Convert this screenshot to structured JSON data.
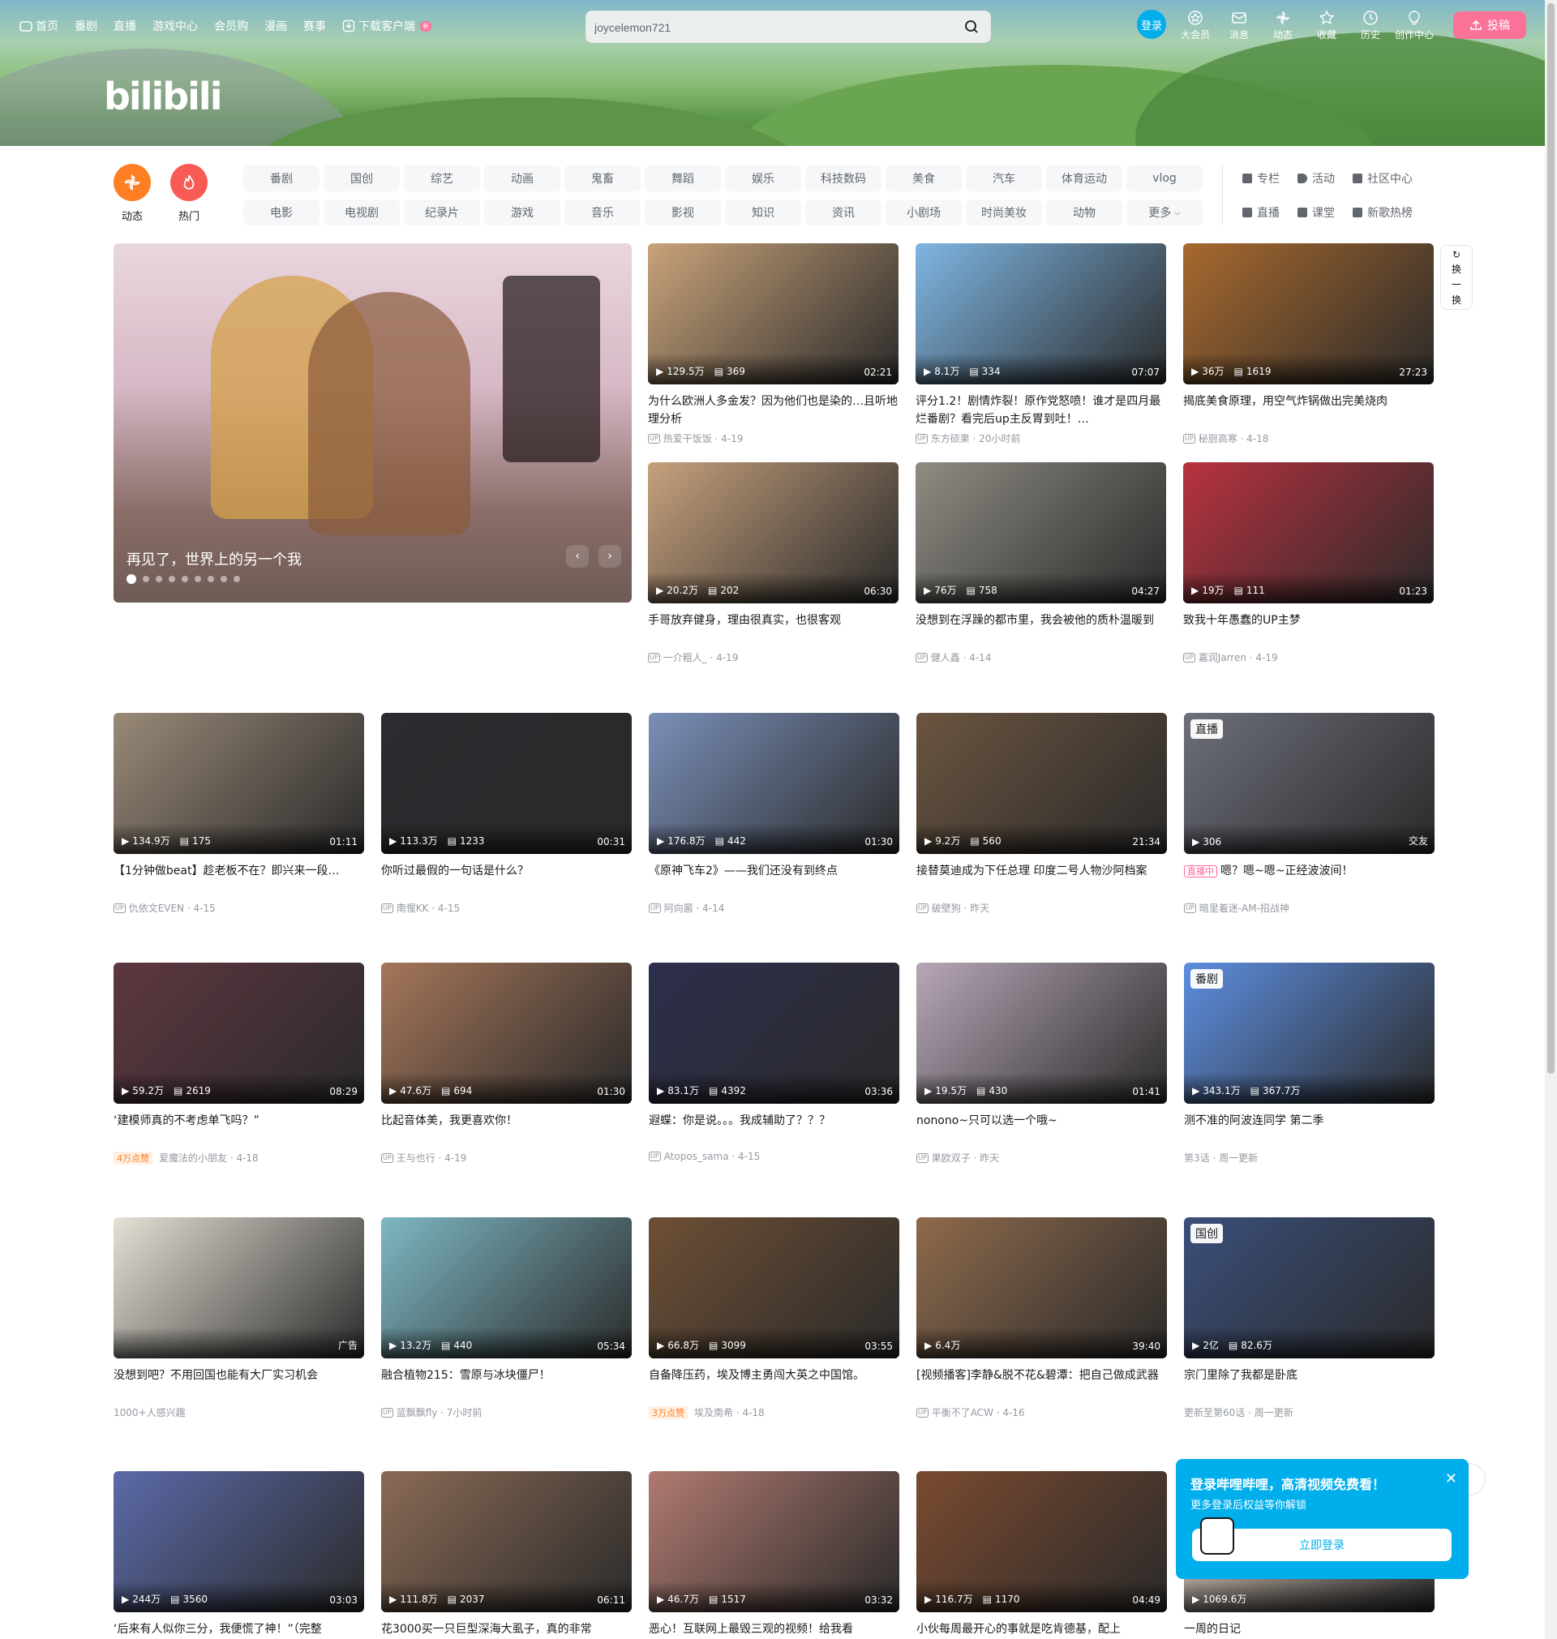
{
  "header": {
    "nav_left": [
      "首页",
      "番剧",
      "直播",
      "游戏中心",
      "会员购",
      "漫画",
      "赛事",
      "下载客户端"
    ],
    "new_badge": "新",
    "search_value": "joycelemon721",
    "login": "登录",
    "nav_right": [
      "大会员",
      "消息",
      "动态",
      "收藏",
      "历史",
      "创作中心"
    ],
    "upload": "投稿",
    "logo": "bilibili"
  },
  "channels": {
    "dynamic": "动态",
    "hot": "热门",
    "tags": [
      "番剧",
      "国创",
      "综艺",
      "动画",
      "鬼畜",
      "舞蹈",
      "娱乐",
      "科技数码",
      "美食",
      "汽车",
      "体育运动",
      "vlog",
      "电影",
      "电视剧",
      "纪录片",
      "游戏",
      "音乐",
      "影视",
      "知识",
      "资讯",
      "小剧场",
      "时尚美妆",
      "动物",
      "更多"
    ],
    "right": [
      "专栏",
      "活动",
      "社区中心",
      "直播",
      "课堂",
      "新歌热榜"
    ]
  },
  "carousel": {
    "title": "再见了，世界上的另一个我",
    "dots": 9,
    "active": 0
  },
  "refresh": [
    "换",
    "一",
    "换"
  ],
  "cards": [
    {
      "title": "为什么欧洲人多金发？因为他们也是染的…且听地理分析",
      "author": "热爱干饭饭",
      "date": "4-19",
      "views": "129.5万",
      "danmaku": "369",
      "dur": "02:21",
      "bg": "#c9a37a"
    },
    {
      "title": "评分1.2！剧情炸裂！原作党怒喷！谁才是四月最烂番剧？看完后up主反胃到吐！…",
      "author": "东方硕果",
      "date": "20小时前",
      "views": "8.1万",
      "danmaku": "334",
      "dur": "07:07",
      "bg": "#7fb6e3"
    },
    {
      "title": "揭底美食原理，用空气炸锅做出完美烧肉",
      "author": "秘厨高寒",
      "date": "4-18",
      "views": "36万",
      "danmaku": "1619",
      "dur": "27:23",
      "bg": "#a8692e"
    },
    {
      "title": "手哥放弃健身，理由很真实，也很客观",
      "author": "一介粗人_",
      "date": "4-19",
      "views": "20.2万",
      "danmaku": "202",
      "dur": "06:30",
      "bg": "#c6a17d"
    },
    {
      "title": "没想到在浮躁的都市里，我会被他的质朴温暖到",
      "author": "健人鑫",
      "date": "4-14",
      "views": "76万",
      "danmaku": "758",
      "dur": "04:27",
      "bg": "#8f8c83"
    },
    {
      "title": "致我十年愚蠢的UP主梦",
      "author": "嘉润Jarren",
      "date": "4-19",
      "views": "19万",
      "danmaku": "111",
      "dur": "01:23",
      "bg": "#b8323f"
    },
    {
      "title": "【1分钟做beat】趁老板不在？即兴来一段…",
      "author": "仇依文EVEN",
      "date": "4-15",
      "views": "134.9万",
      "danmaku": "175",
      "dur": "01:11",
      "bg": "#9a8a78"
    },
    {
      "title": "你听过最假的一句话是什么？",
      "author": "南惺KK",
      "date": "4-15",
      "views": "113.3万",
      "danmaku": "1233",
      "dur": "00:31",
      "bg": "#2b2b30"
    },
    {
      "title": "《原神飞车2》——我们还没有到终点",
      "author": "阿向菌",
      "date": "4-14",
      "views": "176.8万",
      "danmaku": "442",
      "dur": "01:30",
      "bg": "#7a8fb8"
    },
    {
      "title": "接替莫迪成为下任总理 印度二号人物沙阿档案",
      "author": "破壁狗",
      "date": "昨天",
      "views": "9.2万",
      "danmaku": "560",
      "dur": "21:34",
      "bg": "#6b5540"
    },
    {
      "title": "嗯？嗯~嗯~正经波波间！",
      "author": "暗里着迷-AM-招战神",
      "date": "",
      "views": "306",
      "danmaku": "",
      "dur": "交友",
      "bg": "#6d6f7a",
      "live": "直播",
      "livetag": "直播中"
    },
    {
      "title": "‘建模师真的不考虑单飞吗？”",
      "author": "爱魔法的小朋友",
      "date": "4-18",
      "views": "59.2万",
      "danmaku": "2619",
      "dur": "08:29",
      "bg": "#5e3740",
      "hot": "4万点赞"
    },
    {
      "title": "比起音体美，我更喜欢你！",
      "author": "王与也行",
      "date": "4-19",
      "views": "47.6万",
      "danmaku": "694",
      "dur": "01:30",
      "bg": "#a5765a"
    },
    {
      "title": "遐蝶：你是说。。。我成辅助了？？？",
      "author": "Atopos_sama",
      "date": "4-15",
      "views": "83.1万",
      "danmaku": "4392",
      "dur": "03:36",
      "bg": "#2d2f4d"
    },
    {
      "title": "nonono~只可以选一个哦~",
      "author": "果欧双子",
      "date": "昨天",
      "views": "19.5万",
      "danmaku": "430",
      "dur": "01:41",
      "bg": "#b7a7b7"
    },
    {
      "title": "测不准的阿波连同学 第二季",
      "author": "",
      "date": "",
      "views": "343.1万",
      "danmaku": "367.7万",
      "dur": "",
      "bg": "#5d8ee0",
      "corner": "番剧",
      "extra": "第3话 · 周一更新"
    },
    {
      "title": "没想到吧？不用回国也能有大厂实习机会",
      "author": "",
      "date": "",
      "views": "",
      "danmaku": "",
      "dur": "",
      "bg": "#e6e1d6",
      "ad": "广告",
      "extra": "1000+人感兴趣"
    },
    {
      "title": "融合植物215：雪原与冰块僵尸！",
      "author": "蓝飘飘fly",
      "date": "7小时前",
      "views": "13.2万",
      "danmaku": "440",
      "dur": "05:34",
      "bg": "#7eb8c4"
    },
    {
      "title": "自备降压药，埃及博主勇闯大英之中国馆。",
      "author": "埃及南希",
      "date": "4-18",
      "views": "66.8万",
      "danmaku": "3099",
      "dur": "03:55",
      "bg": "#6e4f35",
      "hot": "3万点赞"
    },
    {
      "title": "[视频播客]李静&脱不花&碧潭：把自己做成武器",
      "author": "平衡不了ACW",
      "date": "4-16",
      "views": "6.4万",
      "danmaku": "",
      "dur": "39:40",
      "bg": "#8e6a4c"
    },
    {
      "title": "宗门里除了我都是卧底",
      "author": "",
      "date": "",
      "views": "2亿",
      "danmaku": "82.6万",
      "dur": "",
      "bg": "#3b4f7a",
      "corner": "国创",
      "extra": "更新至第60话 · 周一更新"
    },
    {
      "title": "‘后来有人似你三分，我便慌了神！”（完整",
      "author": "",
      "date": "",
      "views": "244万",
      "danmaku": "3560",
      "dur": "03:03",
      "bg": "#5b6aa8"
    },
    {
      "title": "花3000买一只巨型深海大虱子，真的非常",
      "author": "",
      "date": "",
      "views": "111.8万",
      "danmaku": "2037",
      "dur": "06:11",
      "bg": "#8a6a55"
    },
    {
      "title": "恶心！互联网上最毁三观的视频！给我看",
      "author": "",
      "date": "",
      "views": "46.7万",
      "danmaku": "1517",
      "dur": "03:32",
      "bg": "#b07a70"
    },
    {
      "title": "小伙每周最开心的事就是吃肯德基，配上",
      "author": "",
      "date": "",
      "views": "116.7万",
      "danmaku": "1170",
      "dur": "04:49",
      "bg": "#7a4a30"
    },
    {
      "title": "一周的日记",
      "author": "",
      "date": "",
      "views": "1069.6万",
      "danmaku": "",
      "dur": "",
      "bg": "#d8c8bc"
    }
  ],
  "popup": {
    "title": "登录哔哩哔哩，高清视频免费看！",
    "sub": "更多登录后权益等你解锁",
    "button": "立即登录"
  }
}
